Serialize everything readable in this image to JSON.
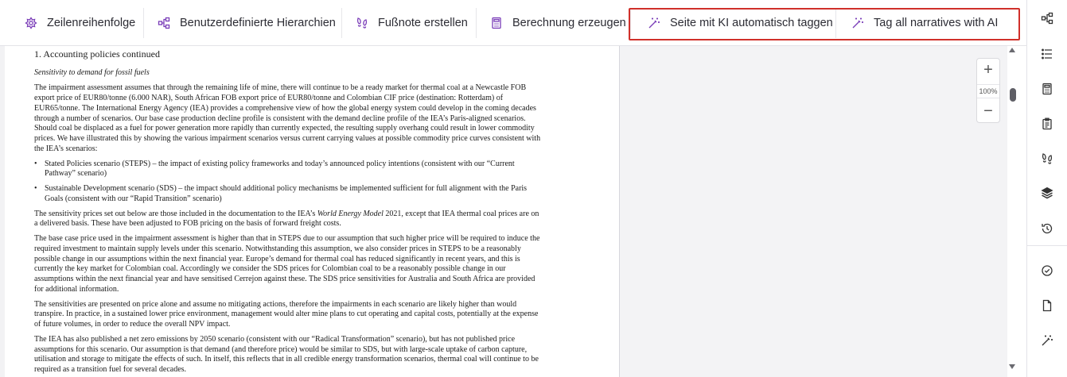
{
  "toolbar": {
    "items": [
      {
        "label": "Zeilenreihenfolge",
        "icon": "sort-rows-icon"
      },
      {
        "label": "Benutzerdefinierte Hierarchien",
        "icon": "hierarchy-icon"
      },
      {
        "label": "Fußnote erstellen",
        "icon": "footnote-icon"
      },
      {
        "label": "Berechnung erzeugen",
        "icon": "calculator-icon"
      },
      {
        "label": "Seite mit KI automatisch taggen",
        "icon": "magic-wand-icon"
      },
      {
        "label": "Tag all narratives with AI",
        "icon": "magic-wand-icon"
      }
    ],
    "highlight_color": "#d0302a",
    "icon_color": "#7a3db8"
  },
  "document": {
    "heading": "1. Accounting policies continued",
    "subheading": "Sensitivity to demand for fossil fuels",
    "paragraph1": "The impairment assessment assumes that through the remaining life of mine, there will continue to be a ready market for thermal coal at a Newcastle FOB export price of EUR80/tonne (6.000 NAR), South African FOB export price of EUR80/tonne and Colombian CIF price (destination: Rotterdam) of EUR65/tonne. The International Energy Agency (IEA) provides a comprehensive view of how the global energy system could develop in the coming decades through a number of scenarios. Our base case production decline profile is consistent with the demand decline profile of the IEA’s Paris-aligned scenarios. Should coal be displaced as a fuel for power generation more rapidly than currently expected, the resulting supply overhang could result in lower commodity prices. We have illustrated this by showing the various impairment scenarios versus current carrying values at possible commodity price curves consistent with the IEA’s scenarios:",
    "bullet1": "Stated Policies scenario (STEPS) – the impact of existing policy frameworks and today’s announced policy intentions (consistent with our “Current Pathway” scenario)",
    "bullet2": "Sustainable Development scenario (SDS) – the impact should additional policy mechanisms be implemented sufficient for full alignment with the Paris Goals (consistent with our “Rapid Transition” scenario)",
    "paragraph2_a": "The sensitivity prices set out below are those included in the documentation to the IEA’s ",
    "paragraph2_em": "World Energy Model",
    "paragraph2_b": " 2021, except that IEA thermal coal prices are on a delivered basis. These have been adjusted to FOB pricing on the basis of forward freight costs.",
    "paragraph3": "The base case price used in the impairment assessment is higher than that in STEPS due to our assumption that such higher price will be required to induce the required investment to maintain supply levels under this scenario. Notwithstanding this assumption, we also consider prices in STEPS to be a reasonably possible change in our assumptions within the next financial year. Europe’s demand for thermal coal has reduced significantly in recent years, and this is currently the key market for Colombian coal. Accordingly we consider the SDS prices for Colombian coal to be a reasonably possible change in our assumptions within the next financial year and have sensitised Cerrejon against these. The SDS price sensitivities for Australia and South Africa are provided for additional information.",
    "paragraph4": "The sensitivities are presented on price alone and assume no mitigating actions, therefore the impairments in each scenario are likely higher than would transpire. In practice, in a sustained lower price environment, management would alter mine plans to cut operating and capital costs, potentially at the expense of future volumes, in order to reduce the overall NPV impact.",
    "paragraph5": "The IEA has also published a net zero emissions by 2050 scenario (consistent with our “Radical Transformation” scenario), but has not published price assumptions for this scenario. Our assumption is that demand (and therefore price) would be similar to SDS, but with large-scale uptake of carbon capture, utilisation and storage to mitigate the effects of such. In itself, this reflects that in all credible energy transformation scenarios, thermal coal will continue to be required as a transition fuel for several decades."
  },
  "zoom": {
    "plus": "+",
    "level": "100%",
    "minus": "−"
  },
  "sidebar": {
    "icons": [
      "hierarchy-icon",
      "list-icon",
      "calculator-icon",
      "clipboard-icon",
      "footnote-icon",
      "layers-icon",
      "history-icon",
      "check-circle-icon",
      "document-icon",
      "magic-wand-icon"
    ]
  }
}
